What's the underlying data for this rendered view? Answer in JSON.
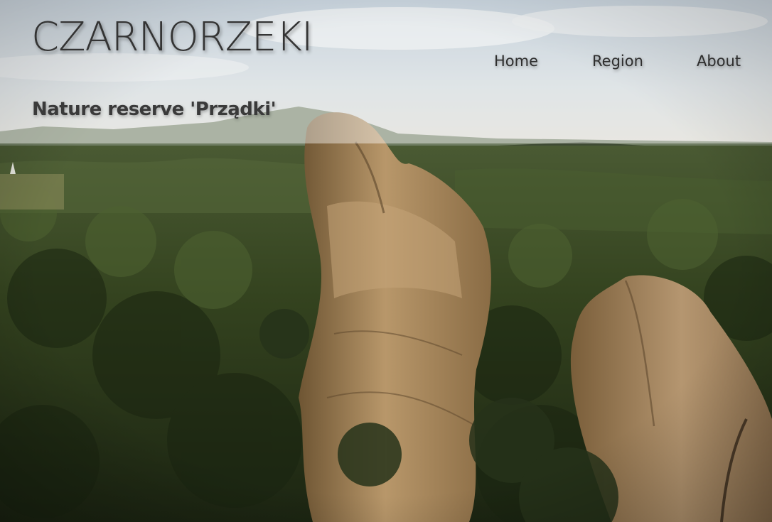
{
  "site": {
    "title": "CZARNORZEKI",
    "subtitle": "Nature reserve 'Prządki'"
  },
  "nav": {
    "items": [
      {
        "label": "Home"
      },
      {
        "label": "Region"
      },
      {
        "label": "About"
      }
    ]
  },
  "colors": {
    "title_text": "#343434",
    "nav_text": "#2e2e2e",
    "header_overlay": "rgba(255,255,255,0.42)",
    "forest": "#2f3b1f",
    "rock": "#a88a60"
  },
  "background": {
    "icon": "hero-landscape-image"
  }
}
